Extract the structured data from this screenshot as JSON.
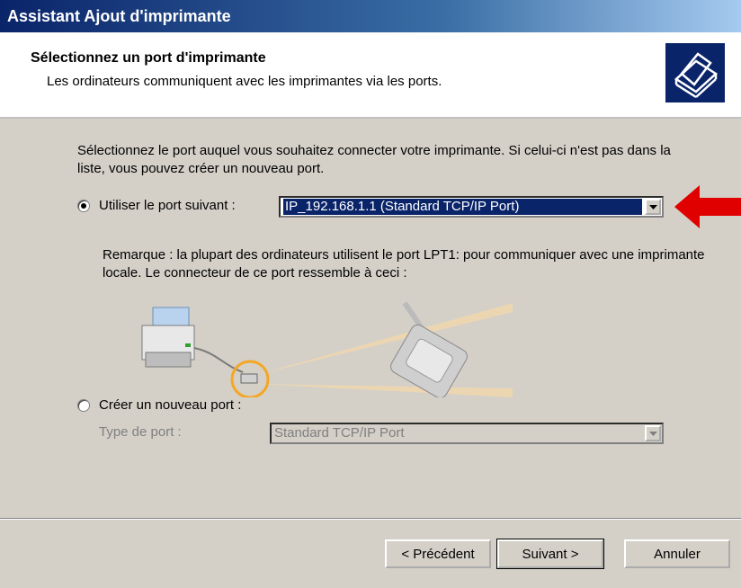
{
  "window": {
    "title": "Assistant Ajout d'imprimante"
  },
  "header": {
    "title": "Sélectionnez un port d'imprimante",
    "subtitle": "Les ordinateurs communiquent avec les imprimantes via les ports.",
    "icon": "printer-icon"
  },
  "main": {
    "intro": "Sélectionnez le port auquel vous souhaitez connecter votre imprimante. Si celui-ci n'est pas dans la liste, vous pouvez créer un nouveau port.",
    "use_port": {
      "label": "Utiliser le port suivant :",
      "selected": true,
      "value": "IP_192.168.1.1 (Standard TCP/IP Port)"
    },
    "note": "Remarque : la plupart des ordinateurs utilisent le port LPT1: pour communiquer avec une imprimante locale. Le connecteur de ce port ressemble à ceci :",
    "create_port": {
      "label": "Créer un nouveau port :",
      "selected": false,
      "type_label": "Type de port :",
      "type_value": "Standard TCP/IP Port"
    }
  },
  "footer": {
    "back_label": "< Précédent",
    "next_label": "Suivant >",
    "cancel_label": "Annuler"
  },
  "annotation": {
    "arrow_color": "#e00000"
  }
}
